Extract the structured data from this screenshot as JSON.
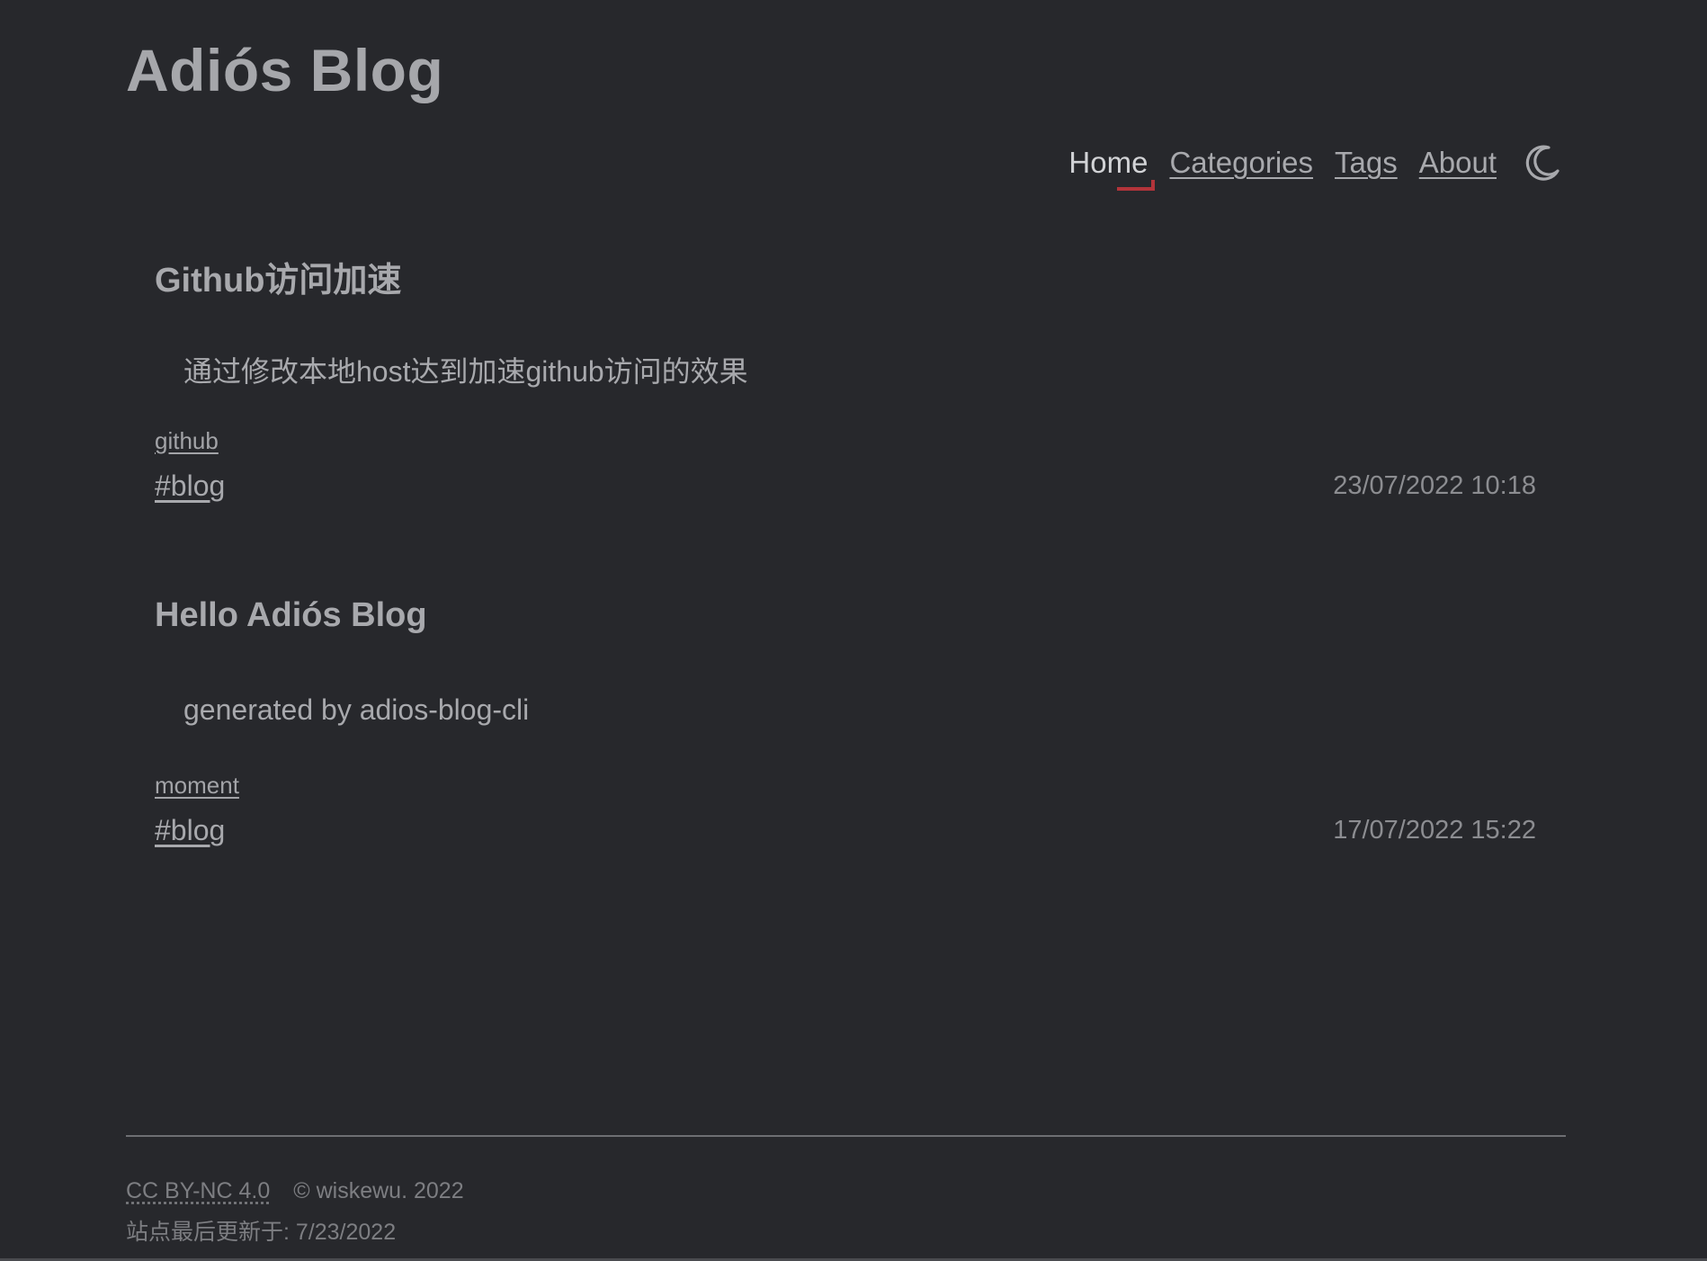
{
  "header": {
    "site_title": "Adiós Blog"
  },
  "nav": {
    "items": [
      {
        "label": "Home",
        "active": true
      },
      {
        "label": "Categories",
        "active": false
      },
      {
        "label": "Tags",
        "active": false
      },
      {
        "label": "About",
        "active": false
      }
    ],
    "theme_toggle_icon": "moon-icon"
  },
  "posts": [
    {
      "title": "Github访问加速",
      "summary": "通过修改本地host达到加速github访问的效果",
      "category": "github",
      "tag": "#blog",
      "date": "23/07/2022 10:18"
    },
    {
      "title": "Hello Adiós Blog",
      "summary": "generated by adios-blog-cli",
      "category": "moment",
      "tag": "#blog",
      "date": "17/07/2022 15:22"
    }
  ],
  "footer": {
    "license": "CC BY-NC 4.0",
    "copyright": "© wiskewu. 2022",
    "last_updated": "站点最后更新于: 7/23/2022"
  },
  "colors": {
    "background": "#27282c",
    "text": "#a8a9ad",
    "accent": "#b3343a"
  }
}
